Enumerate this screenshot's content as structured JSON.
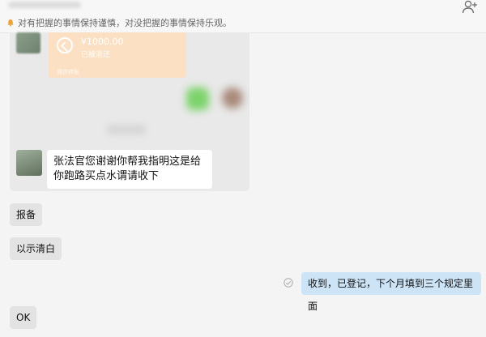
{
  "header": {
    "notice": "对有把握的事情保持谨慎，对没把握的事情保持乐观。"
  },
  "quoted_chat": {
    "transfer": {
      "amount": "¥1000.00",
      "status": "已被退还",
      "footer": "微信转账"
    },
    "message": "张法官您谢谢你帮我指明这是给你跑路买点水谓请收下"
  },
  "messages": [
    {
      "side": "left",
      "text": "报备"
    },
    {
      "side": "left",
      "text": "以示清白"
    },
    {
      "side": "right",
      "text": "收到，已登记，下个月填到三个规定里面"
    },
    {
      "side": "left",
      "text": "OK"
    }
  ],
  "colors": {
    "transfer_bg": "#fbe0c4",
    "outgoing_bubble": "#cde4f7",
    "incoming_bubble": "#e3e3e3"
  },
  "icons": {
    "notice": "bell-icon",
    "add_user": "add-user-icon",
    "refund": "refund-icon",
    "read": "check-circle-icon"
  }
}
